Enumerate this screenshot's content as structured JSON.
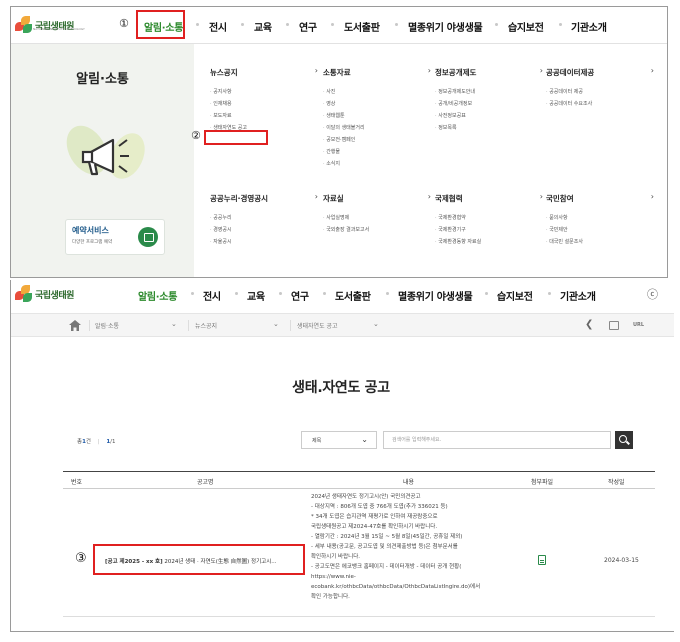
{
  "panel1": {
    "logo_text": "국립생태원",
    "logo_sub": "NATIONAL INSTITUTE OF ECOLOGY",
    "nav": [
      {
        "label": "알림·소통",
        "active": true
      },
      {
        "label": "전시"
      },
      {
        "label": "교육"
      },
      {
        "label": "연구"
      },
      {
        "label": "도서출판"
      },
      {
        "label": "멸종위기 야생생물"
      },
      {
        "label": "습지보전"
      },
      {
        "label": "기관소개"
      }
    ],
    "annot_1": "①",
    "annot_2": "②",
    "left_title": "알림·소통",
    "reservation": {
      "title": "예약서비스",
      "sub": "다양한 프로그램 예약"
    },
    "columns": [
      {
        "head": "뉴스공지",
        "arrow": "›",
        "items": [
          "공지사항",
          "인재채용",
          "보도자료",
          "생태자연도 공고"
        ]
      },
      {
        "head": "소통자료",
        "arrow": "›",
        "items": [
          "사진",
          "영상",
          "생태웹툰",
          "이달의 생태볼거리",
          "공모전·캠페인",
          "간행물",
          "소식지"
        ]
      },
      {
        "head": "정보공개제도",
        "arrow": "›",
        "items": [
          "정보공개제도안내",
          "공개/비공개정보",
          "사전정보공표",
          "정보목록"
        ]
      },
      {
        "head": "공공데이터제공",
        "arrow": "›",
        "items": [
          "공공데이터 제공",
          "공공데이터 수요조사"
        ]
      },
      {
        "head": "공공누리·경영공시",
        "arrow": "›",
        "items": [
          "공공누리",
          "경영공시",
          "자율공시"
        ]
      },
      {
        "head": "자료실",
        "arrow": "›",
        "items": [
          "사업실명제",
          "국외출장 결과보고서"
        ]
      },
      {
        "head": "국제협력",
        "arrow": "›",
        "items": [
          "국제환경협약",
          "국제환경기구",
          "국제환경동향 자료실"
        ]
      },
      {
        "head": "국민참여",
        "arrow": "›",
        "items": [
          "묻의사항",
          "국민제안",
          "대국민 설문조사"
        ]
      }
    ]
  },
  "panel2": {
    "logo_text": "국립생태원",
    "nav": [
      {
        "label": "알림·소통",
        "active": true
      },
      {
        "label": "전시"
      },
      {
        "label": "교육"
      },
      {
        "label": "연구"
      },
      {
        "label": "도서출판"
      },
      {
        "label": "멸종위기 야생생물"
      },
      {
        "label": "습지보전"
      },
      {
        "label": "기관소개"
      }
    ],
    "right_icon": "ⓒ",
    "breadcrumb": [
      "알림·소통",
      "뉴스공지",
      "생태자연도 공고"
    ],
    "url_label": "URL",
    "page_title": "생태.자연도 공고",
    "count_prefix": "총",
    "count_total": "1",
    "count_unit": "건",
    "page_current": "1",
    "page_total": "1",
    "select_value": "제목",
    "search_placeholder": "검색어를 입력해주세요.",
    "table": {
      "headers": [
        "번호",
        "공고명",
        "내용",
        "첨부파일",
        "작성일"
      ],
      "row": {
        "annot": "③",
        "title_bold": "[공고 제2025 - xx 호]",
        "title_rest": " 2024년 생태 · 자연도(生態 自然圖) 정기고시...",
        "content_lines": [
          "2024년 생태자연도 정기고시(안) 국민의견공고",
          "- 대상지역 : 806개 도엽 중 766개 도엽(추가 336021 등)",
          "* 34개 도엽은 습지관역 재평가로 인하여 재공람중으로",
          "국립생태원공고 제2024-47호를 확인하시기 바랍니다.",
          "- 열람기간 : 2024년 3월 15일 ~ 5월 8일(45일간, 공휴일 제외)",
          "- 세부 내용(공고문, 공고도엽 및 의견제출방법 등)은 첨부문서를",
          "확인하시기 바랍니다.",
          "- 공고도면은 에코뱅크 홈페이지 - 데이터개방 - 데이터 공개 현황(",
          "https://www.nie-",
          "ecobank.kr/othbcData/othbcData/OthbcDataListIngire.do)에서",
          "확인 가능합니다."
        ],
        "date": "2024-03-15"
      }
    }
  },
  "colors": {
    "accent_green": "#2d8a2d",
    "highlight_red": "#e02020",
    "link_blue": "#1f5aa8"
  }
}
